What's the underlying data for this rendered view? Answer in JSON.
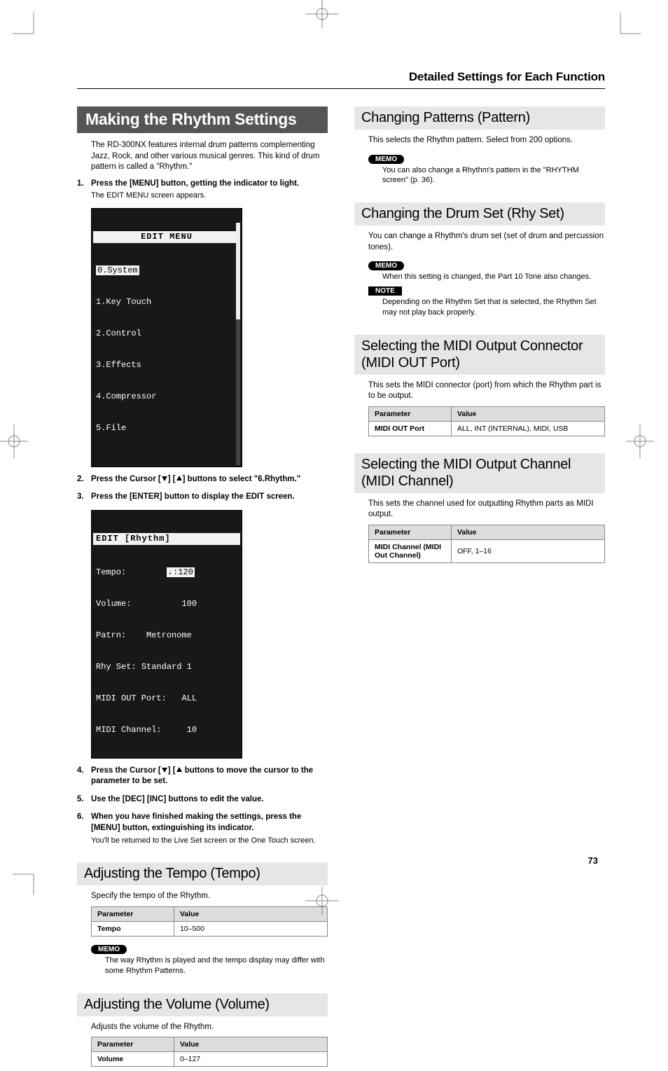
{
  "header": "Detailed Settings for Each Function",
  "pageNumber": "73",
  "left": {
    "mainTitle": "Making the Rhythm Settings",
    "intro": "The RD-300NX features internal drum patterns complementing Jazz, Rock, and other various musical genres. This kind of drum pattern is called a \"Rhythm.\"",
    "step1": "Press the [MENU] button, getting the indicator to light.",
    "step1sub": "The EDIT MENU screen appears.",
    "lcd1": {
      "title": "EDIT MENU",
      "l0": "0.System",
      "l1": "1.Key Touch",
      "l2": "2.Control",
      "l3": "3.Effects",
      "l4": "4.Compressor",
      "l5": "5.File"
    },
    "step2a": "Press the Cursor [",
    "step2b": "] [",
    "step2c": "] buttons to select \"6.Rhythm.\"",
    "step3": "Press the [ENTER] button to display the EDIT screen.",
    "lcd2": {
      "title": "EDIT [Rhythm]",
      "tempo_k": "Tempo:",
      "tempo_v": "♩:120",
      "vol_k": "Volume:",
      "vol_v": "100",
      "patrn_k": "Patrn:",
      "patrn_v": "Metronome",
      "rhy_k": "Rhy Set:",
      "rhy_v": "Standard 1",
      "midiout_k": "MIDI OUT Port:",
      "midiout_v": "ALL",
      "midich_k": "MIDI Channel:",
      "midich_v": "10"
    },
    "step4a": "Press the Cursor [",
    "step4b": "] [",
    "step4c": " buttons to move the cursor to the parameter to be set.",
    "step5": "Use the [DEC] [INC] buttons to edit the value.",
    "step6": "When you have finished making the settings, press the [MENU] button, extinguishing its indicator.",
    "step6sub": "You'll be returned to the Live Set screen or the One Touch screen.",
    "tempo": {
      "title": "Adjusting the Tempo (Tempo)",
      "desc": "Specify the tempo of the Rhythm.",
      "th1": "Parameter",
      "th2": "Value",
      "k": "Tempo",
      "v": "10–500",
      "memo": "The way Rhythm is played and the tempo display may differ with some Rhythm Patterns."
    },
    "volume": {
      "title": "Adjusting the Volume (Volume)",
      "desc": "Adjusts the volume of the Rhythm.",
      "th1": "Parameter",
      "th2": "Value",
      "k": "Volume",
      "v": "0–127"
    }
  },
  "right": {
    "pattern": {
      "title": "Changing Patterns (Pattern)",
      "desc": "This selects the Rhythm pattern. Select from 200 options.",
      "memo": "You can also change a Rhythm's pattern in the \"RHYTHM screen\" (p. 36)."
    },
    "rhyset": {
      "title": "Changing the Drum Set (Rhy Set)",
      "desc": "You can change a Rhythm's drum set (set of drum and percussion tones).",
      "memo": "When this setting is changed, the Part 10 Tone also changes.",
      "note": "Depending on the Rhythm Set that is selected, the Rhythm Set may not play back properly."
    },
    "midiout": {
      "title": "Selecting the MIDI Output Connector (MIDI OUT Port)",
      "desc": "This sets the MIDI connector (port) from which the Rhythm part is to be output.",
      "th1": "Parameter",
      "th2": "Value",
      "k": "MIDI OUT Port",
      "v": "ALL, INT (INTERNAL), MIDI, USB"
    },
    "midich": {
      "title": "Selecting the MIDI Output Channel (MIDI Channel)",
      "desc": "This sets the channel used for outputting Rhythm parts as MIDI output.",
      "th1": "Parameter",
      "th2": "Value",
      "k": "MIDI Channel (MIDI Out Channel)",
      "v": "OFF, 1–16"
    }
  },
  "labels": {
    "memo": "MEMO",
    "note": "NOTE"
  }
}
